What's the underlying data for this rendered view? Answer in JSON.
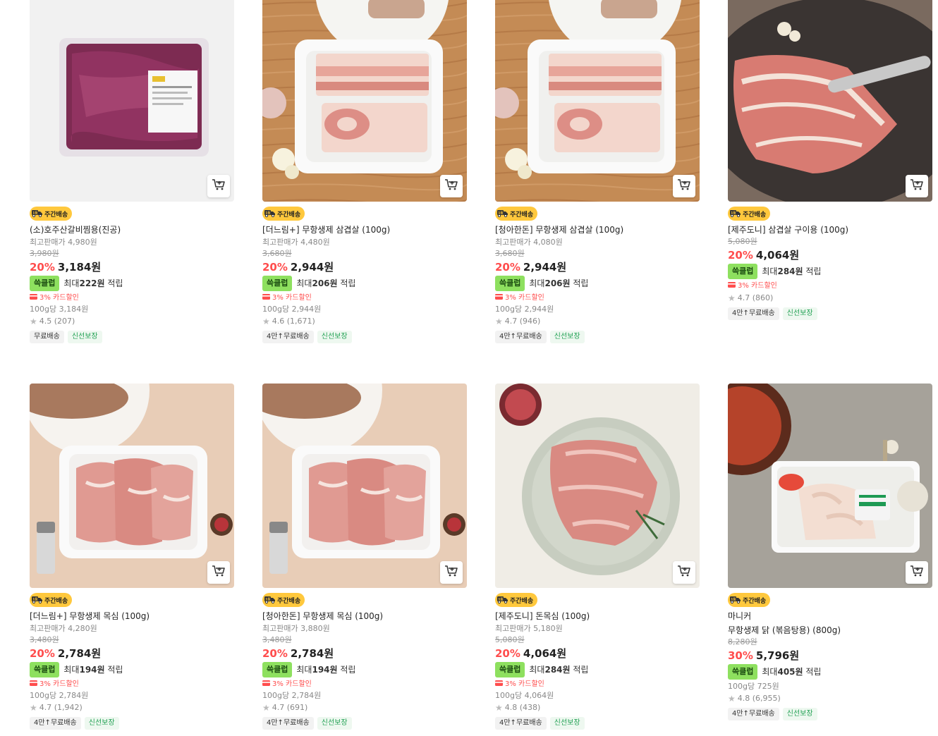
{
  "products": [
    {
      "badge": "주간배송",
      "title": "(소)호주산갈비찜용(진공)",
      "max_price": "최고판매가 4,980원",
      "orig": "3,980원",
      "discount": "20%",
      "price": "3,184원",
      "club": "쓱클럽",
      "club_prefix": "최대",
      "club_amount": "222원",
      "club_suffix": "적립",
      "card_discount": "3% 카드할인",
      "unit_price": "100g당 3,184원",
      "rating": "4.5 (207)",
      "tags": [
        "무료배송",
        "신선보장"
      ],
      "image": "vacuum-pack"
    },
    {
      "badge": "주간배송",
      "title": "[더느림+] 무항생제 삼겹살 (100g)",
      "max_price": "최고판매가 4,480원",
      "orig": "3,680원",
      "discount": "20%",
      "price": "2,944원",
      "club": "쓱클럽",
      "club_prefix": "최대",
      "club_amount": "206원",
      "club_suffix": "적립",
      "card_discount": "3% 카드할인",
      "unit_price": "100g당 2,944원",
      "rating": "4.6 (1,671)",
      "tags": [
        "4만↑무료배송",
        "신선보장"
      ],
      "image": "pork-belly-tray"
    },
    {
      "badge": "주간배송",
      "title": "[청아한돈] 무항생제 삼겹살 (100g)",
      "max_price": "최고판매가 4,080원",
      "orig": "3,680원",
      "discount": "20%",
      "price": "2,944원",
      "club": "쓱클럽",
      "club_prefix": "최대",
      "club_amount": "206원",
      "club_suffix": "적립",
      "card_discount": "3% 카드할인",
      "unit_price": "100g당 2,944원",
      "rating": "4.7 (946)",
      "tags": [
        "4만↑무료배송",
        "신선보장"
      ],
      "image": "pork-belly-tray"
    },
    {
      "badge": "주간배송",
      "title": "[제주도니] 삼겹살 구이용 (100g)",
      "orig": "5,080원",
      "discount": "20%",
      "price": "4,064원",
      "club": "쓱클럽",
      "club_prefix": "최대",
      "club_amount": "284원",
      "club_suffix": "적립",
      "card_discount": "3% 카드할인",
      "rating": "4.7 (860)",
      "tags": [
        "4만↑무료배송",
        "신선보장"
      ],
      "image": "pork-belly-tongs"
    },
    {
      "badge": "주간배송",
      "title": "[더느림+] 무항생제 목심 (100g)",
      "max_price": "최고판매가 4,280원",
      "orig": "3,480원",
      "discount": "20%",
      "price": "2,784원",
      "club": "쓱클럽",
      "club_prefix": "최대",
      "club_amount": "194원",
      "club_suffix": "적립",
      "card_discount": "3% 카드할인",
      "unit_price": "100g당 2,784원",
      "rating": "4.7 (1,942)",
      "tags": [
        "4만↑무료배송",
        "신선보장"
      ],
      "image": "neck-tray"
    },
    {
      "badge": "주간배송",
      "title": "[청아한돈] 무항생제 목심 (100g)",
      "max_price": "최고판매가 3,880원",
      "orig": "3,480원",
      "discount": "20%",
      "price": "2,784원",
      "club": "쓱클럽",
      "club_prefix": "최대",
      "club_amount": "194원",
      "club_suffix": "적립",
      "card_discount": "3% 카드할인",
      "unit_price": "100g당 2,784원",
      "rating": "4.7 (691)",
      "tags": [
        "4만↑무료배송",
        "신선보장"
      ],
      "image": "neck-tray"
    },
    {
      "badge": "주간배송",
      "title": "[제주도니] 돈목심 (100g)",
      "max_price": "최고판매가 5,180원",
      "orig": "5,080원",
      "discount": "20%",
      "price": "4,064원",
      "club": "쓱클럽",
      "club_prefix": "최대",
      "club_amount": "284원",
      "club_suffix": "적립",
      "card_discount": "3% 카드할인",
      "unit_price": "100g당 4,064원",
      "rating": "4.8 (438)",
      "tags": [
        "4만↑무료배송",
        "신선보장"
      ],
      "image": "neck-plate"
    },
    {
      "badge": "주간배송",
      "brand": "마니커",
      "title": "무항생제 닭 (볶음탕용) (800g)",
      "orig": "8,280원",
      "discount": "30%",
      "price": "5,796원",
      "club": "쓱클럽",
      "club_prefix": "최대",
      "club_amount": "405원",
      "club_suffix": "적립",
      "unit_price": "100g당 725원",
      "rating": "4.8 (6,955)",
      "tags": [
        "4만↑무료배송",
        "신선보장"
      ],
      "image": "chicken-tray"
    }
  ]
}
